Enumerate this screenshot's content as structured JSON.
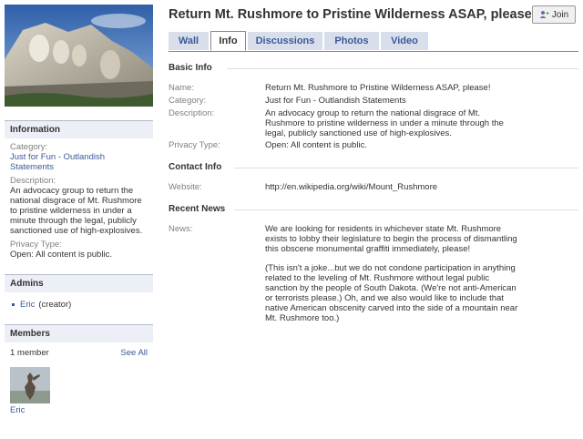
{
  "group": {
    "title": "Return Mt. Rushmore to Pristine Wilderness ASAP, please!",
    "join_label": "Join"
  },
  "tabs": [
    {
      "label": "Wall",
      "active": false
    },
    {
      "label": "Info",
      "active": true
    },
    {
      "label": "Discussions",
      "active": false
    },
    {
      "label": "Photos",
      "active": false
    },
    {
      "label": "Video",
      "active": false
    }
  ],
  "sidebar": {
    "information": {
      "header": "Information",
      "category_label": "Category:",
      "category_value": "Just for Fun - Outlandish Statements",
      "description_label": "Description:",
      "description_value": "An advocacy group to return the national disgrace of Mt. Rushmore to pristine wilderness in under a minute through the legal, publicly sanctioned use of high-explosives.",
      "privacy_label": "Privacy Type:",
      "privacy_value": "Open: All content is public."
    },
    "admins": {
      "header": "Admins",
      "admin_name": "Eric",
      "admin_role": "(creator)"
    },
    "members": {
      "header": "Members",
      "count": "1 member",
      "see_all": "See All",
      "member_name": "Eric"
    }
  },
  "basic_info": {
    "header": "Basic Info",
    "name_label": "Name:",
    "name_value": "Return Mt. Rushmore to Pristine Wilderness ASAP, please!",
    "category_label": "Category:",
    "category_value": "Just for Fun - Outlandish Statements",
    "description_label": "Description:",
    "description_value": "An advocacy group to return the national disgrace of Mt. Rushmore to pristine wilderness in under a minute through the legal, publicly sanctioned use of high-explosives.",
    "privacy_label": "Privacy Type:",
    "privacy_value": "Open: All content is public."
  },
  "contact_info": {
    "header": "Contact Info",
    "website_label": "Website:",
    "website_value": "http://en.wikipedia.org/wiki/Mount_Rushmore"
  },
  "recent_news": {
    "header": "Recent News",
    "news_label": "News:",
    "paragraph_1": "We are looking for residents in whichever state Mt. Rushmore exists to lobby their legislature to begin the process of dismantling this obscene monumental graffiti immediately, please!",
    "paragraph_2": "(This isn't a joke...but we do not condone participation in anything related to the leveling of Mt. Rushmore without legal public sanction by the people of South Dakota. (We're not anti-American or terrorists please.) Oh, and we also would like to include that native American obscenity carved into the side of a mountain near Mt. Rushmore too.)"
  }
}
